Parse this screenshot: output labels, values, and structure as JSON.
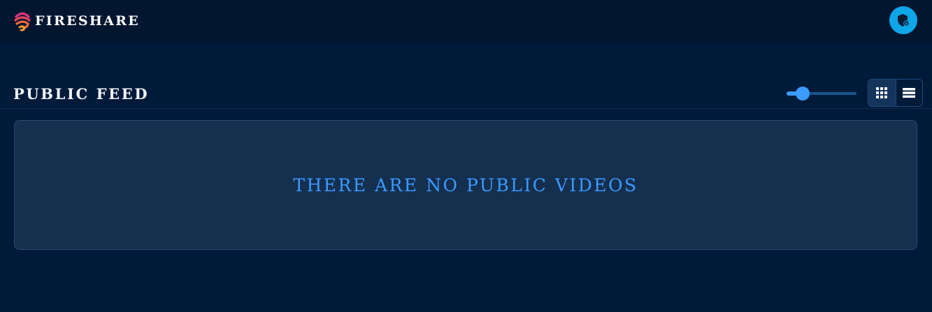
{
  "header": {
    "brand_name": "FIRESHARE",
    "logo_icon": "fireshare-logo-icon",
    "admin_icon": "admin-shield-icon"
  },
  "feed": {
    "title": "PUBLIC FEED",
    "card_size_level": 0.23,
    "view_mode": "grid",
    "grid_icon": "grid-view-icon",
    "list_icon": "list-view-icon",
    "empty_message": "THERE ARE NO PUBLIC VIDEOS"
  },
  "colors": {
    "accent": "#3b9bff",
    "admin_button": "#0ea5e9",
    "background": "#001a3a",
    "panel": "#152f4f"
  }
}
